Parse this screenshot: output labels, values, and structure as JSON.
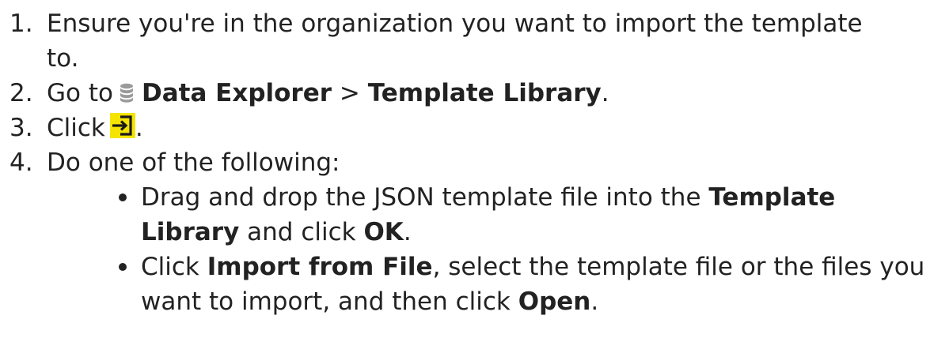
{
  "steps": [
    {
      "number": "1.",
      "line1": "Ensure you're in the organization you want to import the template",
      "line2": "to."
    },
    {
      "number": "2.",
      "prefix": "Go to",
      "icon": "database-icon",
      "link1": "Data Explorer",
      "separator": ">",
      "link2": "Template Library",
      "suffix": "."
    },
    {
      "number": "3.",
      "prefix": "Click",
      "icon": "import-icon",
      "suffix": "."
    },
    {
      "number": "4.",
      "text": "Do one of the following:"
    }
  ],
  "bullets": [
    {
      "l1_text": "Drag and drop the JSON template file into the",
      "l1_bold": "Template",
      "l2_bold": "Library",
      "l2_text": "and click",
      "l2_bold2": "OK",
      "l2_end": "."
    },
    {
      "l1_text_a": "Click",
      "l1_bold": "Import from File",
      "l1_text_b": ", select the template file or the files you",
      "l2_text": "want to import, and then click",
      "l2_bold": "Open",
      "l2_end": "."
    }
  ],
  "colors": {
    "text": "#222222",
    "icon_bg": "#f5e400",
    "icon_fg": "#1b1b1b",
    "db_icon": "#9a9a9a"
  }
}
